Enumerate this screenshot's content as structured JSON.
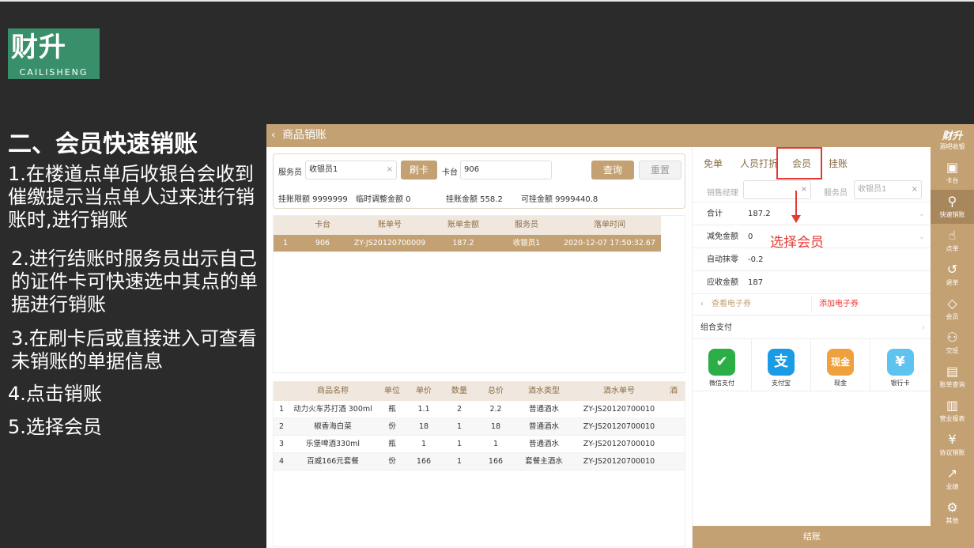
{
  "logo": {
    "mark": "财升",
    "sub": "CAILISHENG"
  },
  "slide": {
    "title": "二、会员快速销账",
    "steps": [
      "1.在楼道点单后收银台会收到催缴提示当点单人过来进行销账时,进行销账",
      "2.进行结账时服务员出示自己的证件卡可快速选中其点的单据进行销账",
      "3.在刷卡后或直接进入可查看未销账的单据信息",
      "4.点击销账",
      "5.选择会员"
    ]
  },
  "app": {
    "header": {
      "back": "‹",
      "title": "商品销账"
    },
    "form": {
      "waiter_label": "服务员",
      "waiter_value": "收银员1",
      "swipe_btn": "刷卡",
      "table_label": "卡台",
      "table_value": "906",
      "query_btn": "查询",
      "reset_btn": "重置",
      "limit": "挂账限额  9999999",
      "temp_adjust": "临时调整金额  0",
      "credit_amount": "挂账金额  558.2",
      "available": "可挂金额  9999440.8"
    },
    "bills": {
      "headers": [
        "卡台",
        "账单号",
        "账单金额",
        "服务员",
        "落单时间"
      ],
      "rows": [
        [
          "1",
          "906",
          "ZY-JS20120700009",
          "187.2",
          "收银员1",
          "2020-12-07 17:50:32.67"
        ]
      ]
    },
    "items": {
      "headers": [
        "商品名称",
        "单位",
        "单价",
        "数量",
        "总价",
        "酒水类型",
        "酒水单号",
        "酒"
      ],
      "rows": [
        [
          "1",
          "动力火车苏打酒 300ml",
          "瓶",
          "1.1",
          "2",
          "2.2",
          "普通酒水",
          "ZY-JS20120700010"
        ],
        [
          "2",
          "椒香海白菜",
          "份",
          "18",
          "1",
          "18",
          "普通酒水",
          "ZY-JS20120700010"
        ],
        [
          "3",
          "乐堡啤酒330ml",
          "瓶",
          "1",
          "1",
          "1",
          "普通酒水",
          "ZY-JS20120700010"
        ],
        [
          "4",
          "百威166元套餐",
          "份",
          "166",
          "1",
          "166",
          "套餐主酒水",
          "ZY-JS20120700010"
        ]
      ]
    },
    "right": {
      "tabs": [
        "免单",
        "人员打折",
        "会员",
        "挂账"
      ],
      "manager_label": "销售经理",
      "server_label": "服务员",
      "server_value": "收银员1",
      "total_label": "合计",
      "total_value": "187.2",
      "discount_label": "减免金额",
      "discount_value": "0",
      "round_label": "自动抹零",
      "round_value": "-0.2",
      "due_label": "应收金额",
      "due_value": "187",
      "view_coupon": "查看电子券",
      "add_coupon": "添加电子券",
      "combo_pay": "组合支付",
      "payments": [
        "微信支付",
        "支付宝",
        "现金",
        "银行卡"
      ],
      "checkout": "结账"
    },
    "annotation": "选择会员",
    "sidebar": {
      "title": "财升",
      "subtitle": "酒吧收银",
      "items": [
        "卡台",
        "快速销账",
        "点单",
        "退单",
        "会员",
        "交班",
        "账单查询",
        "营业报表",
        "协议销账",
        "业绩",
        "其他"
      ]
    }
  },
  "colors": {
    "accent": "#c3a173",
    "annotation": "#e53935",
    "background": "#2b2b2b"
  }
}
